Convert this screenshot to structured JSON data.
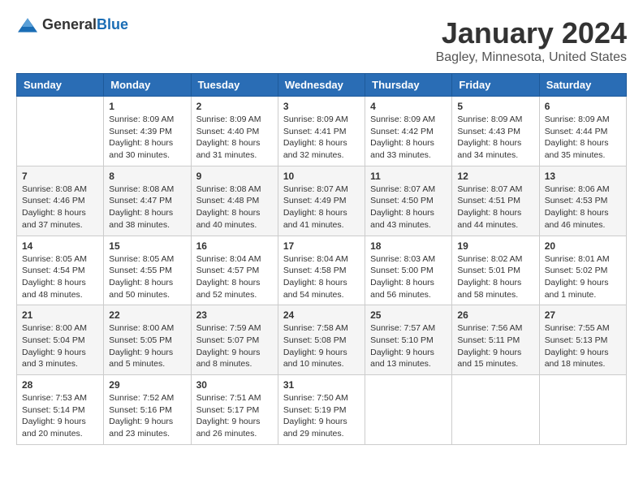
{
  "logo": {
    "general": "General",
    "blue": "Blue"
  },
  "title": {
    "month": "January 2024",
    "location": "Bagley, Minnesota, United States"
  },
  "weekdays": [
    "Sunday",
    "Monday",
    "Tuesday",
    "Wednesday",
    "Thursday",
    "Friday",
    "Saturday"
  ],
  "weeks": [
    [
      {
        "day": "",
        "info": ""
      },
      {
        "day": "1",
        "info": "Sunrise: 8:09 AM\nSunset: 4:39 PM\nDaylight: 8 hours\nand 30 minutes."
      },
      {
        "day": "2",
        "info": "Sunrise: 8:09 AM\nSunset: 4:40 PM\nDaylight: 8 hours\nand 31 minutes."
      },
      {
        "day": "3",
        "info": "Sunrise: 8:09 AM\nSunset: 4:41 PM\nDaylight: 8 hours\nand 32 minutes."
      },
      {
        "day": "4",
        "info": "Sunrise: 8:09 AM\nSunset: 4:42 PM\nDaylight: 8 hours\nand 33 minutes."
      },
      {
        "day": "5",
        "info": "Sunrise: 8:09 AM\nSunset: 4:43 PM\nDaylight: 8 hours\nand 34 minutes."
      },
      {
        "day": "6",
        "info": "Sunrise: 8:09 AM\nSunset: 4:44 PM\nDaylight: 8 hours\nand 35 minutes."
      }
    ],
    [
      {
        "day": "7",
        "info": "Sunrise: 8:08 AM\nSunset: 4:46 PM\nDaylight: 8 hours\nand 37 minutes."
      },
      {
        "day": "8",
        "info": "Sunrise: 8:08 AM\nSunset: 4:47 PM\nDaylight: 8 hours\nand 38 minutes."
      },
      {
        "day": "9",
        "info": "Sunrise: 8:08 AM\nSunset: 4:48 PM\nDaylight: 8 hours\nand 40 minutes."
      },
      {
        "day": "10",
        "info": "Sunrise: 8:07 AM\nSunset: 4:49 PM\nDaylight: 8 hours\nand 41 minutes."
      },
      {
        "day": "11",
        "info": "Sunrise: 8:07 AM\nSunset: 4:50 PM\nDaylight: 8 hours\nand 43 minutes."
      },
      {
        "day": "12",
        "info": "Sunrise: 8:07 AM\nSunset: 4:51 PM\nDaylight: 8 hours\nand 44 minutes."
      },
      {
        "day": "13",
        "info": "Sunrise: 8:06 AM\nSunset: 4:53 PM\nDaylight: 8 hours\nand 46 minutes."
      }
    ],
    [
      {
        "day": "14",
        "info": "Sunrise: 8:05 AM\nSunset: 4:54 PM\nDaylight: 8 hours\nand 48 minutes."
      },
      {
        "day": "15",
        "info": "Sunrise: 8:05 AM\nSunset: 4:55 PM\nDaylight: 8 hours\nand 50 minutes."
      },
      {
        "day": "16",
        "info": "Sunrise: 8:04 AM\nSunset: 4:57 PM\nDaylight: 8 hours\nand 52 minutes."
      },
      {
        "day": "17",
        "info": "Sunrise: 8:04 AM\nSunset: 4:58 PM\nDaylight: 8 hours\nand 54 minutes."
      },
      {
        "day": "18",
        "info": "Sunrise: 8:03 AM\nSunset: 5:00 PM\nDaylight: 8 hours\nand 56 minutes."
      },
      {
        "day": "19",
        "info": "Sunrise: 8:02 AM\nSunset: 5:01 PM\nDaylight: 8 hours\nand 58 minutes."
      },
      {
        "day": "20",
        "info": "Sunrise: 8:01 AM\nSunset: 5:02 PM\nDaylight: 9 hours\nand 1 minute."
      }
    ],
    [
      {
        "day": "21",
        "info": "Sunrise: 8:00 AM\nSunset: 5:04 PM\nDaylight: 9 hours\nand 3 minutes."
      },
      {
        "day": "22",
        "info": "Sunrise: 8:00 AM\nSunset: 5:05 PM\nDaylight: 9 hours\nand 5 minutes."
      },
      {
        "day": "23",
        "info": "Sunrise: 7:59 AM\nSunset: 5:07 PM\nDaylight: 9 hours\nand 8 minutes."
      },
      {
        "day": "24",
        "info": "Sunrise: 7:58 AM\nSunset: 5:08 PM\nDaylight: 9 hours\nand 10 minutes."
      },
      {
        "day": "25",
        "info": "Sunrise: 7:57 AM\nSunset: 5:10 PM\nDaylight: 9 hours\nand 13 minutes."
      },
      {
        "day": "26",
        "info": "Sunrise: 7:56 AM\nSunset: 5:11 PM\nDaylight: 9 hours\nand 15 minutes."
      },
      {
        "day": "27",
        "info": "Sunrise: 7:55 AM\nSunset: 5:13 PM\nDaylight: 9 hours\nand 18 minutes."
      }
    ],
    [
      {
        "day": "28",
        "info": "Sunrise: 7:53 AM\nSunset: 5:14 PM\nDaylight: 9 hours\nand 20 minutes."
      },
      {
        "day": "29",
        "info": "Sunrise: 7:52 AM\nSunset: 5:16 PM\nDaylight: 9 hours\nand 23 minutes."
      },
      {
        "day": "30",
        "info": "Sunrise: 7:51 AM\nSunset: 5:17 PM\nDaylight: 9 hours\nand 26 minutes."
      },
      {
        "day": "31",
        "info": "Sunrise: 7:50 AM\nSunset: 5:19 PM\nDaylight: 9 hours\nand 29 minutes."
      },
      {
        "day": "",
        "info": ""
      },
      {
        "day": "",
        "info": ""
      },
      {
        "day": "",
        "info": ""
      }
    ]
  ]
}
